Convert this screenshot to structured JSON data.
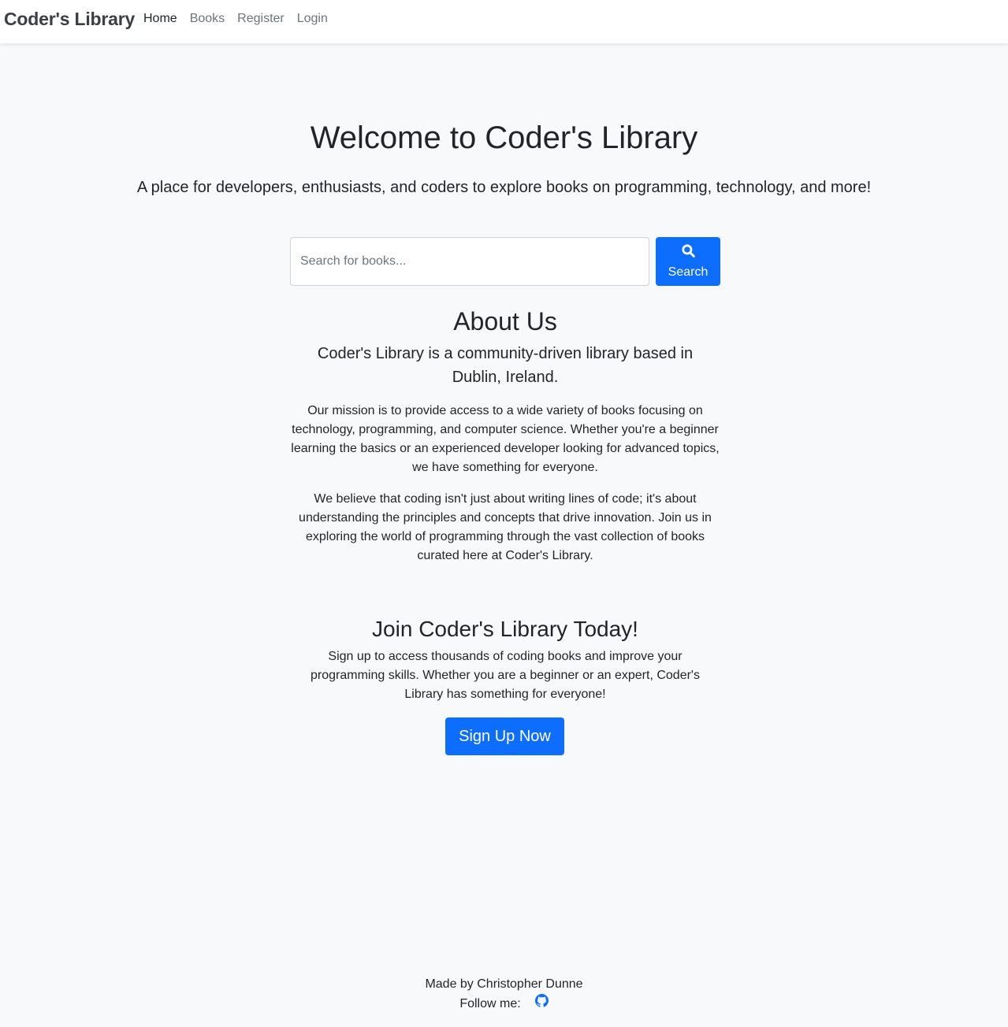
{
  "navbar": {
    "brand": "Coder's Library",
    "links": [
      {
        "label": "Home",
        "active": true
      },
      {
        "label": "Books",
        "active": false
      },
      {
        "label": "Register",
        "active": false
      },
      {
        "label": "Login",
        "active": false
      }
    ]
  },
  "hero": {
    "title": "Welcome to Coder's Library",
    "lead": "A place for developers, enthusiasts, and coders to explore books on programming, technology, and more!"
  },
  "search": {
    "placeholder": "Search for books...",
    "value": "",
    "button_label": "Search",
    "button_icon": "search-icon"
  },
  "about": {
    "heading": "About Us",
    "lead": "Coder's Library is a community-driven library based in Dublin, Ireland.",
    "paragraphs": [
      "Our mission is to provide access to a wide variety of books focusing on technology, programming, and computer science. Whether you're a beginner learning the basics or an experienced developer looking for advanced topics, we have something for everyone.",
      "We believe that coding isn't just about writing lines of code; it's about understanding the principles and concepts that drive innovation. Join us in exploring the world of programming through the vast collection of books curated here at Coder's Library."
    ]
  },
  "join": {
    "heading": "Join Coder's Library Today!",
    "text": "Sign up to access thousands of coding books and improve your programming skills. Whether you are a beginner or an expert, Coder's Library has something for everyone!",
    "button_label": "Sign Up Now"
  },
  "footer": {
    "made_by": "Made by Christopher Dunne",
    "follow_label": "Follow me:",
    "social_icon": "github-icon"
  },
  "colors": {
    "primary": "#0d6efd",
    "background": "#f8f9fa",
    "navbar_bg": "#ffffff",
    "text": "#212529",
    "muted": "#6c757d"
  }
}
